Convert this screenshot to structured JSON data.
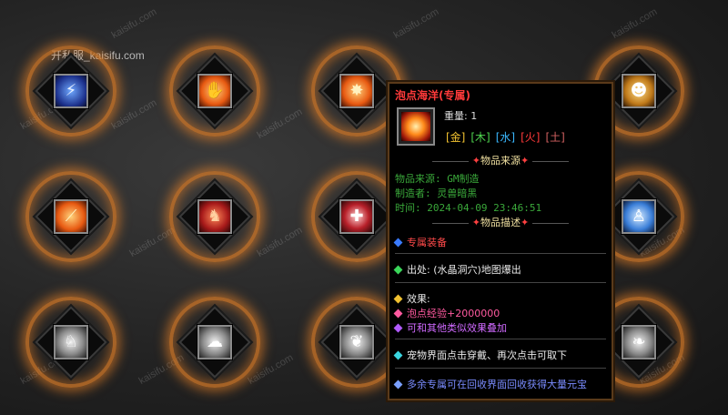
{
  "watermark": {
    "top_text": "开私服_kaisifu.com",
    "repeat_text": "kaisifu.com"
  },
  "grid_slots": [
    {
      "icon": "blue-lightning-icon"
    },
    {
      "icon": "fire-hand-icon"
    },
    {
      "icon": "fire-burst-icon"
    },
    {
      "icon": "gold-face-icon"
    },
    {
      "icon": "fire-claw-icon"
    },
    {
      "icon": "red-beast-icon"
    },
    {
      "icon": "red-shield-cross-icon"
    },
    {
      "icon": "ice-figure-icon"
    },
    {
      "icon": "silver-animal-icon"
    },
    {
      "icon": "silver-beast-icon"
    },
    {
      "icon": "silver-dragon-icon"
    },
    {
      "icon": "silver-bird-icon"
    }
  ],
  "tooltip": {
    "title": "泡点海洋(专属)",
    "weight": "重量: 1",
    "elements": [
      "[金]",
      "[木]",
      "[水]",
      "[火]",
      "[土]"
    ],
    "section_source": "物品来源",
    "source_label": "物品来源: GM制造",
    "maker": "制造者: 灵兽暗黑",
    "time": "时间: 2024-04-09 23:46:51",
    "section_desc": "物品描述",
    "exclusive": "专属装备",
    "origin": "出处: (水晶洞穴)地图爆出",
    "effect_label": "效果:",
    "effect_1": "泡点经验+2000000",
    "effect_2": "可和其他类似效果叠加",
    "usage": "宠物界面点击穿戴、再次点击可取下",
    "recycle": "多余专属可在回收界面回收获得大量元宝"
  },
  "colors": {
    "title_red": "#ff3a3a",
    "green_text": "#3aa83a",
    "border": "#5a3a1a"
  }
}
